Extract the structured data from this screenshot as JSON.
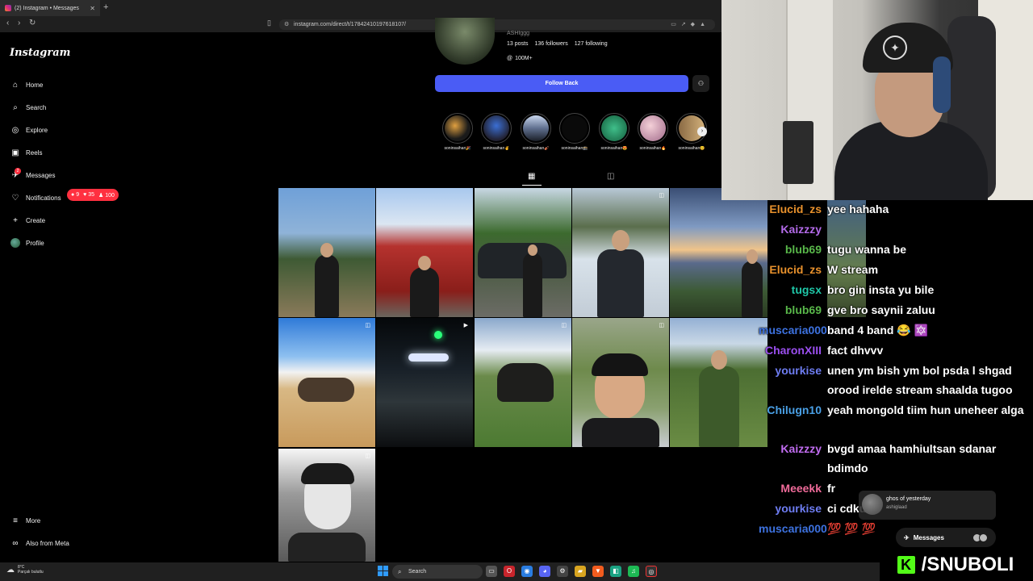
{
  "browser": {
    "tab_title": "(2) Instagram • Messages",
    "url": "instagram.com/direct/t/17842410197618107/"
  },
  "instagram": {
    "logo": "Instagram",
    "nav": [
      {
        "label": "Home",
        "icon": "home-icon"
      },
      {
        "label": "Search",
        "icon": "search-icon"
      },
      {
        "label": "Explore",
        "icon": "compass-icon"
      },
      {
        "label": "Reels",
        "icon": "reels-icon"
      },
      {
        "label": "Messages",
        "icon": "messenger-icon"
      },
      {
        "label": "Notifications",
        "icon": "heart-icon"
      },
      {
        "label": "Create",
        "icon": "plus-icon"
      },
      {
        "label": "Profile",
        "icon": "avatar-icon"
      }
    ],
    "messages_unread": "2",
    "notif_badge": {
      "comments": "9",
      "likes": "35",
      "followers": "100"
    },
    "bottom_nav": [
      {
        "label": "More",
        "icon": "menu-icon"
      },
      {
        "label": "Also from Meta",
        "icon": "meta-icon"
      }
    ]
  },
  "profile": {
    "username_partial": "ASHIggg",
    "posts": "13 posts",
    "followers": "136 followers",
    "following": "127 following",
    "threads": "100M+",
    "follow_back_label": "Follow Back",
    "highlights": [
      "soninsaihan🎉",
      "soninsaihan✌",
      "soninsaihan🎻",
      "soninsaihan🕋",
      "soninsaihan😍",
      "soninsaihan🔥",
      "soninsaihan😊"
    ]
  },
  "chat": [
    {
      "user": "Elucid_zs",
      "color": "#e8912c",
      "msg": "yee hahaha"
    },
    {
      "user": "Kaizzzy",
      "color": "#b26ae8",
      "msg": ""
    },
    {
      "user": "blub69",
      "color": "#59b84a",
      "msg": "tugu wanna be"
    },
    {
      "user": "Elucid_zs",
      "color": "#e8912c",
      "msg": "W stream"
    },
    {
      "user": "tugsx",
      "color": "#1fc7a8",
      "msg": "bro gin insta yu bile"
    },
    {
      "user": "blub69",
      "color": "#59b84a",
      "msg": "gve bro saynii zaluu"
    },
    {
      "user": "muscaria000",
      "color": "#3d72e0",
      "msg": "band 4 band 😂 🔯"
    },
    {
      "user": "CharonXIII",
      "color": "#9b4ff0",
      "msg": "fact dhvvv"
    },
    {
      "user": "yourkise",
      "color": "#6e7df2",
      "msg": "unen ym bish ym bol psda l shgad orood irelde stream shaalda tugoo"
    },
    {
      "user": "Chilugn10",
      "color": "#4aa0e6",
      "msg": "yeah mongold tiim hun uneheer alga"
    },
    {
      "user": "Kaizzzy",
      "color": "#c06cf0",
      "msg": "bvgd amaa hamhiultsan sdanar bdimdo"
    },
    {
      "user": "Meeekk",
      "color": "#f06b9a",
      "msg": "fr"
    },
    {
      "user": "yourkise",
      "color": "#6e7df2",
      "msg": "ci cdku"
    },
    {
      "user": "muscaria000",
      "color": "#3d72e0",
      "msg": "💯 💯 💯"
    }
  ],
  "dm_popup": {
    "name": "ghos of yesterday",
    "sub": "ashiglaad"
  },
  "messages_bar": {
    "label": "Messages",
    "badge": "2"
  },
  "brand": {
    "text": "/SNUBOLI",
    "accent": "#53fc18"
  },
  "taskbar": {
    "weather_temp": "8°C",
    "weather_text": "Parçalı bulutlu",
    "search_label": "Search"
  }
}
